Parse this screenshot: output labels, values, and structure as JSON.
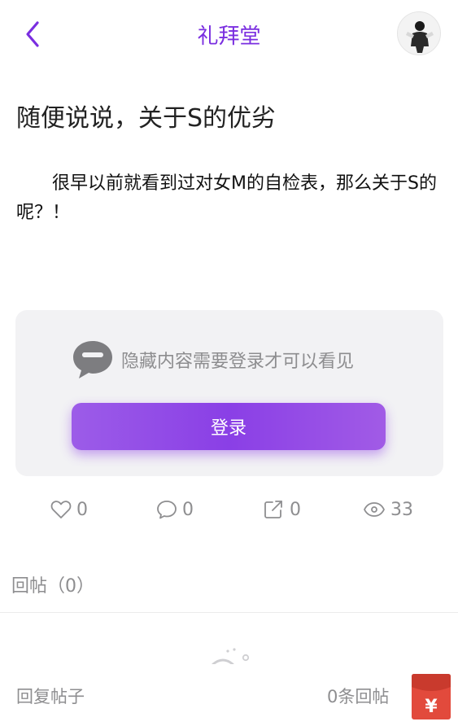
{
  "header": {
    "title": "礼拜堂",
    "back_icon": "chevron-left-icon",
    "accent_color": "#7a2ee0"
  },
  "post": {
    "title": "随便说说，关于S的优劣",
    "body": "很早以前就看到过对女M的自检表，那么关于S的呢？！"
  },
  "hidden_content": {
    "message": "隐藏内容需要登录才可以看见",
    "icon": "chat-bubble-icon",
    "login_label": "登录",
    "button_color": "#8a3fe6"
  },
  "stats": {
    "likes": "0",
    "comments": "0",
    "shares": "0",
    "views": "33"
  },
  "replies": {
    "header": "回帖（0）"
  },
  "bottom_bar": {
    "reply_label": "回复帖子",
    "reply_count_label": "0条回帖",
    "redpack_symbol": "¥",
    "redpack_color": "#e24a3c"
  }
}
